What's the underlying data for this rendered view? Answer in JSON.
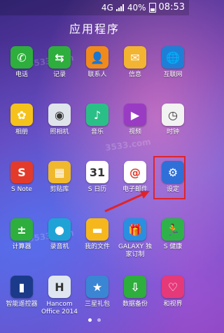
{
  "status_bar": {
    "network": "4G",
    "battery": "40%",
    "time": "08:53"
  },
  "screen_title": "应用程序",
  "apps": [
    {
      "label": "电话",
      "icon": "phone-icon",
      "color": "#2eae3c",
      "glyph": "✆"
    },
    {
      "label": "记录",
      "icon": "call-log-icon",
      "color": "#2eae3c",
      "glyph": "⇆"
    },
    {
      "label": "联系人",
      "icon": "contacts-icon",
      "color": "#f08a1c",
      "glyph": "👤"
    },
    {
      "label": "信息",
      "icon": "messages-icon",
      "color": "#f3b431",
      "glyph": "✉"
    },
    {
      "label": "互联网",
      "icon": "internet-icon",
      "color": "#1f7fd6",
      "glyph": "🌐"
    },
    {
      "label": "相册",
      "icon": "gallery-icon",
      "color": "#f5c21b",
      "glyph": "✿"
    },
    {
      "label": "照相机",
      "icon": "camera-icon",
      "color": "#dfe4ea",
      "glyph": "◉"
    },
    {
      "label": "音乐",
      "icon": "music-icon",
      "color": "#2bbf88",
      "glyph": "♪"
    },
    {
      "label": "视频",
      "icon": "video-icon",
      "color": "#9a3bc4",
      "glyph": "▶"
    },
    {
      "label": "时钟",
      "icon": "clock-icon",
      "color": "#f2f2f2",
      "glyph": "◷"
    },
    {
      "label": "S Note",
      "icon": "s-note-icon",
      "color": "#e23b2b",
      "glyph": "S"
    },
    {
      "label": "剪贴库",
      "icon": "scrapbook-icon",
      "color": "#f0b82d",
      "glyph": "▦"
    },
    {
      "label": "S 日历",
      "icon": "calendar-icon",
      "color": "#ffffff",
      "glyph": "31"
    },
    {
      "label": "电子邮件",
      "icon": "email-icon",
      "color": "#ffffff",
      "glyph": "@"
    },
    {
      "label": "设定",
      "icon": "settings-icon",
      "color": "#2f6fd8",
      "glyph": "⚙"
    },
    {
      "label": "计算器",
      "icon": "calculator-icon",
      "color": "#2eae3c",
      "glyph": "±"
    },
    {
      "label": "录音机",
      "icon": "voice-recorder-icon",
      "color": "#1fa3d6",
      "glyph": "●"
    },
    {
      "label": "我的文件",
      "icon": "my-files-icon",
      "color": "#f5b71c",
      "glyph": "▬"
    },
    {
      "label": "GALAXY 独家订制",
      "icon": "galaxy-gift-icon",
      "color": "#2a8fe0",
      "glyph": "🎁"
    },
    {
      "label": "S 健康",
      "icon": "s-health-icon",
      "color": "#2fb24a",
      "glyph": "🏃"
    },
    {
      "label": "智能遥控器",
      "icon": "remote-icon",
      "color": "#1b3b8a",
      "glyph": "▮"
    },
    {
      "label": "Hancom Office 2014",
      "icon": "hancom-office-icon",
      "color": "#dfe6f0",
      "glyph": "H"
    },
    {
      "label": "三星礼包",
      "icon": "samsung-gift-icon",
      "color": "#3a86d4",
      "glyph": "★"
    },
    {
      "label": "数据备份",
      "icon": "backup-icon",
      "color": "#2eae3c",
      "glyph": "⇩"
    },
    {
      "label": "和视界",
      "icon": "video-world-icon",
      "color": "#e5397a",
      "glyph": "♡"
    }
  ],
  "watermark_text": "3533.com",
  "page_indicator": {
    "current": 1,
    "total": 2
  }
}
